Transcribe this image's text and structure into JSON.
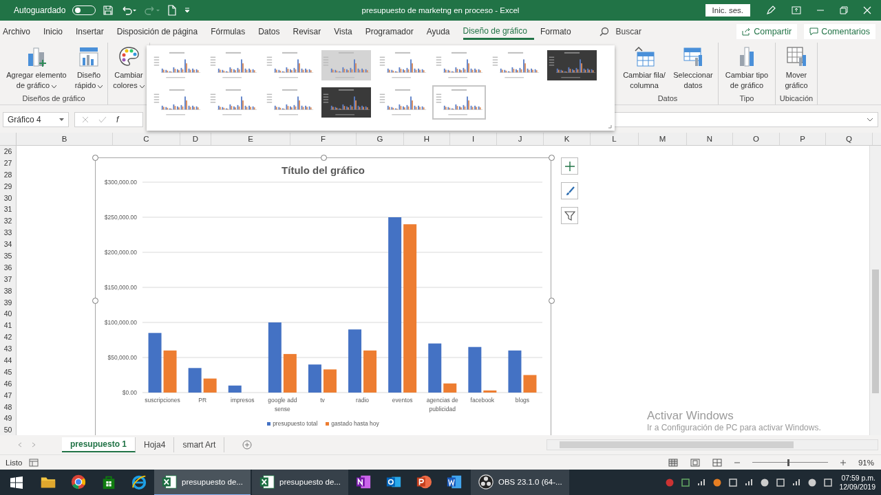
{
  "title_bar": {
    "autosave_label": "Autoguardado",
    "autosave_on": false,
    "document_title": "presupuesto de marketng en proceso  -  Excel",
    "sign_in": "Inic. ses."
  },
  "ribbon_tabs": [
    {
      "label": "Archivo",
      "selected": false
    },
    {
      "label": "Inicio",
      "selected": false
    },
    {
      "label": "Insertar",
      "selected": false
    },
    {
      "label": "Disposición de página",
      "selected": false
    },
    {
      "label": "Fórmulas",
      "selected": false
    },
    {
      "label": "Datos",
      "selected": false
    },
    {
      "label": "Revisar",
      "selected": false
    },
    {
      "label": "Vista",
      "selected": false
    },
    {
      "label": "Programador",
      "selected": false
    },
    {
      "label": "Ayuda",
      "selected": false
    },
    {
      "label": "Diseño de gráfico",
      "selected": true
    },
    {
      "label": "Formato",
      "selected": false
    }
  ],
  "search": {
    "placeholder": "Buscar"
  },
  "share_button": "Compartir",
  "comments_button": "Comentarios",
  "ribbon_left_groups": [
    {
      "label": "Diseños de gráfico",
      "buttons": [
        {
          "kind": "add-element",
          "label": "Agregar elemento de gráfico",
          "dropdown": true
        },
        {
          "kind": "quick-layout",
          "label": "Diseño rápido",
          "dropdown": true
        }
      ]
    },
    {
      "buttons": [
        {
          "kind": "colors",
          "label": "Cambiar colores",
          "dropdown": true
        }
      ]
    }
  ],
  "ribbon_right_groups": [
    {
      "label": "Datos",
      "buttons": [
        {
          "kind": "switch",
          "label": "Cambiar fila/ columna",
          "dropdown": false
        },
        {
          "kind": "select-data",
          "label": "Seleccionar datos",
          "dropdown": false
        }
      ]
    },
    {
      "label": "Tipo",
      "buttons": [
        {
          "kind": "chart-type",
          "label": "Cambiar tipo de gráfico",
          "dropdown": false
        }
      ]
    },
    {
      "label": "Ubicación",
      "buttons": [
        {
          "kind": "move",
          "label": "Mover gráfico",
          "dropdown": false
        }
      ]
    }
  ],
  "chart_styles": [
    {
      "kind": "light",
      "selected": false
    },
    {
      "kind": "light",
      "selected": false
    },
    {
      "kind": "light",
      "selected": false
    },
    {
      "kind": "gray",
      "selected": false
    },
    {
      "kind": "light",
      "selected": false
    },
    {
      "kind": "light",
      "selected": false
    },
    {
      "kind": "light",
      "selected": false
    },
    {
      "kind": "dark",
      "selected": false
    },
    {
      "kind": "light",
      "selected": false
    },
    {
      "kind": "light",
      "selected": false
    },
    {
      "kind": "light",
      "selected": false
    },
    {
      "kind": "dark",
      "selected": false
    },
    {
      "kind": "light",
      "selected": false
    },
    {
      "kind": "light",
      "selected": true
    }
  ],
  "name_box": "Gráfico 4",
  "formula_label": "f",
  "columns": [
    "B",
    "C",
    "D",
    "E",
    "F",
    "G",
    "H",
    "I",
    "J",
    "K",
    "L",
    "M",
    "N",
    "O",
    "P",
    "Q"
  ],
  "rows": [
    "26",
    "27",
    "28",
    "29",
    "30",
    "31",
    "32",
    "33",
    "34",
    "35",
    "36",
    "37",
    "38",
    "39",
    "40",
    "41",
    "42",
    "43",
    "44",
    "45",
    "46",
    "47",
    "48",
    "49",
    "50"
  ],
  "chart": {
    "chart_data": {
      "type": "bar",
      "title": "Título del gráfico",
      "grid": true,
      "legend": true,
      "categories": [
        "suscripciones",
        "PR",
        "impresos",
        "google add sense",
        "tv",
        "radio",
        "eventos",
        "agencias de publicidad",
        "facebook",
        "blogs"
      ],
      "series": [
        {
          "name": "presupuesto total",
          "color": "#4472c4",
          "values": [
            85000,
            35000,
            10000,
            100000,
            40000,
            90000,
            250000,
            70000,
            65000,
            60000
          ]
        },
        {
          "name": "gastado hasta hoy",
          "color": "#ed7d31",
          "values": [
            60000,
            20000,
            0,
            55000,
            33000,
            60000,
            240000,
            13000,
            3000,
            25000
          ]
        }
      ],
      "ylim": [
        0,
        300000
      ],
      "yticks": [
        {
          "value": 0,
          "label": "$0.00"
        },
        {
          "value": 50000,
          "label": "$50,000.00"
        },
        {
          "value": 100000,
          "label": "$100,000.00"
        },
        {
          "value": 150000,
          "label": "$150,000.00"
        },
        {
          "value": 200000,
          "label": "$200,000.00"
        },
        {
          "value": 250000,
          "label": "$250,000.00"
        },
        {
          "value": 300000,
          "label": "$300,000.00"
        }
      ]
    }
  },
  "sheet_tabs": [
    {
      "label": "presupuesto 1",
      "selected": true
    },
    {
      "label": "Hoja4",
      "selected": false
    },
    {
      "label": "smart Art",
      "selected": false
    }
  ],
  "status": "Listo",
  "zoom": "91%",
  "zoom_slider": {
    "level": 0.48
  },
  "activation": {
    "title": "Activar Windows",
    "text": "Ir a Configuración de PC para activar Windows."
  },
  "taskbar": {
    "items": [
      {
        "kind": "folder",
        "selected": false
      },
      {
        "kind": "browser",
        "selected": false
      },
      {
        "kind": "store",
        "selected": false
      },
      {
        "kind": "ie",
        "selected": false
      },
      {
        "kind": "excel",
        "label": "presupuesto de...",
        "selected": true
      },
      {
        "kind": "excel",
        "label": "presupuesto de...",
        "selected": false
      },
      {
        "kind": "onenote",
        "selected": false
      },
      {
        "kind": "outlook",
        "selected": false
      },
      {
        "kind": "powerpoint",
        "selected": false
      },
      {
        "kind": "word",
        "selected": false
      },
      {
        "kind": "obs",
        "label": "OBS 23.1.0 (64-...",
        "selected": false
      }
    ],
    "time": "07:59 p.m.",
    "date": "12/09/2019"
  }
}
